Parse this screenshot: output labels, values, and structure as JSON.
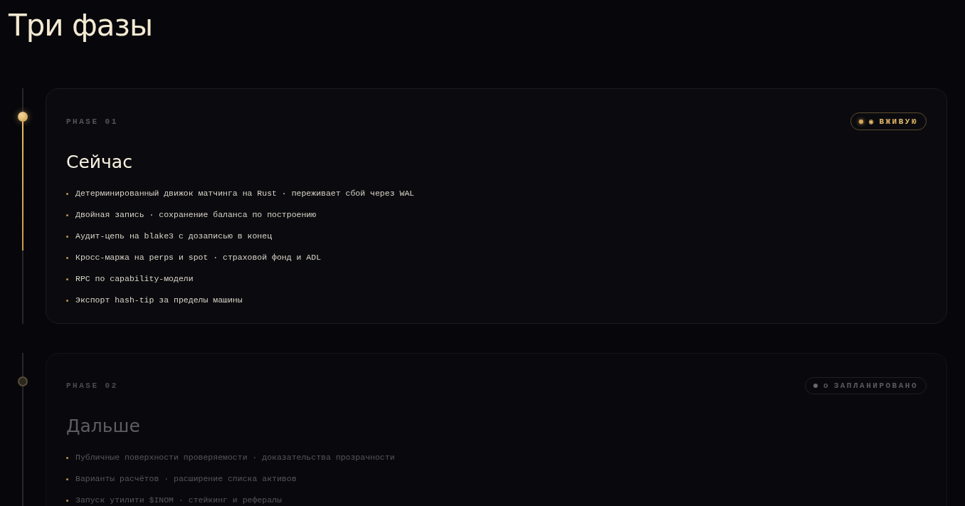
{
  "title": "Три фазы",
  "phases": [
    {
      "label": "PHASE 01",
      "active": true,
      "badge": {
        "symbol": "◉",
        "text": "ВЖИВУЮ"
      },
      "heading": "Сейчас",
      "items": [
        "Детерминированный движок матчинга на Rust · переживает сбой через WAL",
        "Двойная запись · сохранение баланса по построению",
        "Аудит-цепь на blake3 с дозаписью в конец",
        "Кросс-маржа на perps и spot · страховой фонд и ADL",
        "RPC по capability-модели",
        "Экспорт hash-tip за пределы машины"
      ]
    },
    {
      "label": "PHASE 02",
      "active": false,
      "badge": {
        "symbol": "o",
        "text": "ЗАПЛАНИРОВАНО"
      },
      "heading": "Дальше",
      "items": [
        "Публичные поверхности проверяемости · доказательства прозрачности",
        "Варианты расчётов · расширение списка активов",
        "Запуск утилити $INOM · стейкинг и рефералы"
      ]
    }
  ]
}
